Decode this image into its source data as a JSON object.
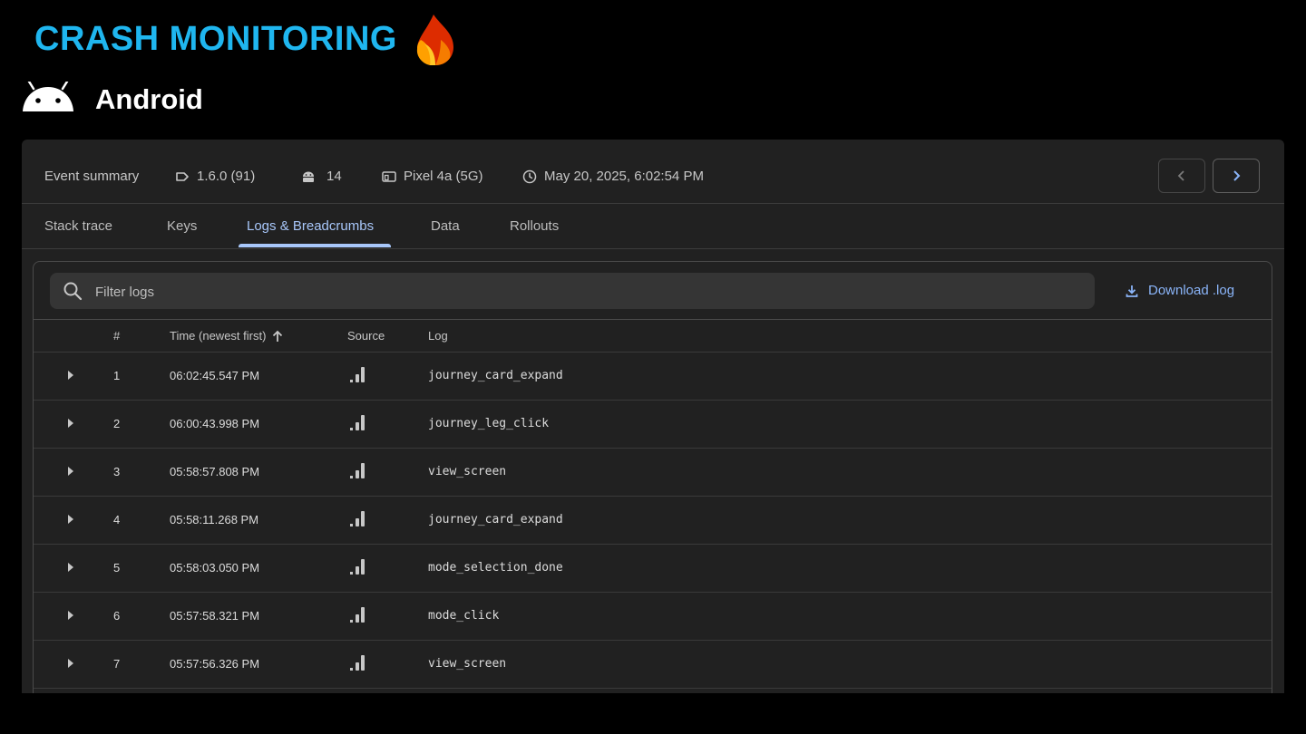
{
  "header": {
    "title": "CRASH MONITORING",
    "logo_icon": "firebase-flame-icon"
  },
  "platform": {
    "label": "Android",
    "icon": "android-icon"
  },
  "summary": {
    "label": "Event summary",
    "version": "1.6.0 (91)",
    "os_version": "14",
    "device": "Pixel 4a (5G)",
    "timestamp": "May 20, 2025, 6:02:54 PM"
  },
  "tabs": [
    {
      "label": "Stack trace"
    },
    {
      "label": "Keys"
    },
    {
      "label": "Logs & Breadcrumbs",
      "active": true
    },
    {
      "label": "Data"
    },
    {
      "label": "Rollouts"
    }
  ],
  "logs": {
    "filter_placeholder": "Filter logs",
    "download_label": "Download .log",
    "columns": {
      "num": "#",
      "time": "Time (newest first)",
      "source": "Source",
      "log": "Log"
    },
    "rows": [
      {
        "num": "1",
        "time": "06:02:45.547 PM",
        "log": "journey_card_expand"
      },
      {
        "num": "2",
        "time": "06:00:43.998 PM",
        "log": "journey_leg_click"
      },
      {
        "num": "3",
        "time": "05:58:57.808 PM",
        "log": "view_screen"
      },
      {
        "num": "4",
        "time": "05:58:11.268 PM",
        "log": "journey_card_expand"
      },
      {
        "num": "5",
        "time": "05:58:03.050 PM",
        "log": "mode_selection_done"
      },
      {
        "num": "6",
        "time": "05:57:58.321 PM",
        "log": "mode_click"
      },
      {
        "num": "7",
        "time": "05:57:56.326 PM",
        "log": "view_screen"
      }
    ]
  },
  "colors": {
    "accent": "#1fb6ef",
    "tab_active": "#a8c7fa",
    "link": "#8ab4f8"
  }
}
